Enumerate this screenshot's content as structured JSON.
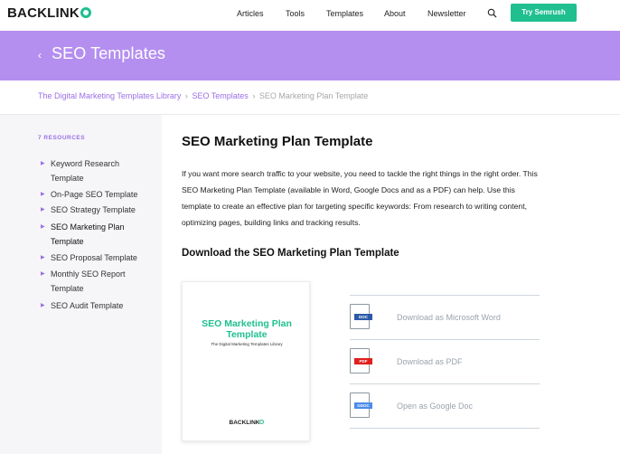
{
  "header": {
    "logo": "BACKLINK",
    "nav": [
      "Articles",
      "Tools",
      "Templates",
      "About",
      "Newsletter"
    ],
    "cta": "Try Semrush"
  },
  "banner": {
    "back_glyph": "‹",
    "title": "SEO Templates"
  },
  "breadcrumb": {
    "items": [
      "The Digital Marketing Templates Library",
      "SEO Templates"
    ],
    "current": "SEO Marketing Plan Template",
    "separator": "›"
  },
  "sidebar": {
    "count": "7 RESOURCES",
    "items": [
      {
        "label": "Keyword Research Template"
      },
      {
        "label": "On-Page SEO Template"
      },
      {
        "label": "SEO Strategy Template"
      },
      {
        "label": "SEO Marketing Plan Template"
      },
      {
        "label": "SEO Proposal Template"
      },
      {
        "label": "Monthly SEO Report Template"
      },
      {
        "label": "SEO Audit Template"
      }
    ]
  },
  "main": {
    "title": "SEO Marketing Plan Template",
    "intro": "If you want more search traffic to your website, you need to tackle the right things in the right order. This SEO Marketing Plan Template (available in Word, Google Docs and as a PDF) can help. Use this template to create an effective plan for targeting specific keywords: From research to writing content, optimizing pages, building links and tracking results.",
    "download_heading": "Download the SEO Marketing Plan Template",
    "preview": {
      "title": "SEO Marketing Plan Template",
      "subtitle": "The Digital Marketing Templates Library",
      "logo": "BACKLINK"
    },
    "downloads": [
      {
        "tag": "DOC",
        "label": "Download as Microsoft Word",
        "color": "#2b5aa8"
      },
      {
        "tag": "PDF",
        "label": "Download as PDF",
        "color": "#e0201b"
      },
      {
        "tag": "GDOC",
        "label": "Open as Google Doc",
        "color": "#4a8bea"
      }
    ]
  },
  "colors": {
    "brand_green": "#1fbf8f",
    "purple": "#b48ff0",
    "link_purple": "#9b6fe6"
  }
}
